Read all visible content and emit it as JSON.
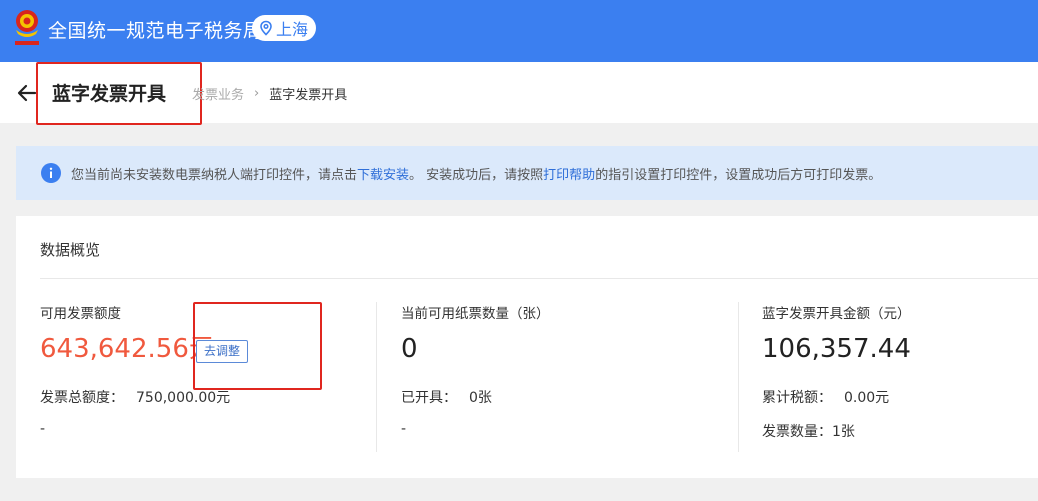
{
  "topbar": {
    "title": "全国统一规范电子税务局",
    "region": "上海",
    "brand_color": "#3b7ff0"
  },
  "header": {
    "page_title": "蓝字发票开具",
    "breadcrumb": [
      "发票业务",
      "蓝字发票开具"
    ]
  },
  "notice": {
    "text_1": "您当前尚未安装数电票纳税人端打印控件，请点击",
    "link_1": "下载安装",
    "text_2": "。 安装成功后，请按照",
    "link_2": "打印帮助",
    "text_3": "的指引设置打印控件，设置成功后方可打印发票。"
  },
  "overview": {
    "title": "数据概览",
    "quota": {
      "label": "可用发票额度",
      "value": "643,642.56元",
      "adjust_label": "去调整",
      "total_label": "发票总额度：",
      "total_value": "750,000.00元",
      "dash": "-"
    },
    "paper": {
      "label": "当前可用纸票数量（张）",
      "value": "0",
      "issued_label": "已开具：",
      "issued_value": "0张",
      "dash": "-"
    },
    "amount": {
      "label": "蓝字发票开具金额（元）",
      "value": "106,357.44",
      "tax_label": "累计税额：",
      "tax_value": "0.00元",
      "count_label": "发票数量：",
      "count_value": "1张"
    }
  },
  "colors": {
    "highlight": "#e0261f",
    "quota_value": "#f0593e",
    "link": "#2f6fd8"
  }
}
